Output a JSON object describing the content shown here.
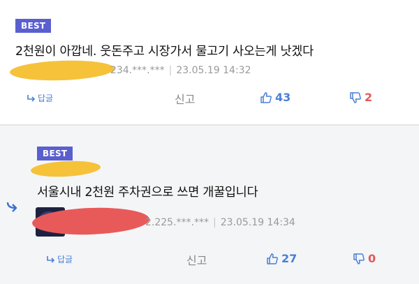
{
  "comments": [
    {
      "badge": "BEST",
      "text": "2천원이 아깝네. 웃돈주고 시장가서 물고기 사오는게 낫겠다",
      "ip": "234.***.***",
      "date": "23.05.19 14:32",
      "reply_label": "답글",
      "report_label": "신고",
      "likes": "43",
      "dislikes": "2",
      "scribble_color": "#f5c23a"
    },
    {
      "badge": "BEST",
      "text": "서울시내 2천원 주차권으로 쓰면 개꿀입니다",
      "ip": "2.225.***.***",
      "date": "23.05.19 14:34",
      "reply_label": "답글",
      "report_label": "신고",
      "likes": "27",
      "dislikes": "0",
      "scribble_color": "#e85a5a",
      "name_scribble_color": "#f5c23a"
    }
  ],
  "colors": {
    "accent": "#4a7fd6",
    "badge_bg": "#5a5fcf",
    "dislike": "#e05a5a"
  },
  "icons": [
    "reply-arrow-icon",
    "thumbs-up-icon",
    "thumbs-down-icon",
    "nested-reply-arrow-icon",
    "avatar"
  ]
}
